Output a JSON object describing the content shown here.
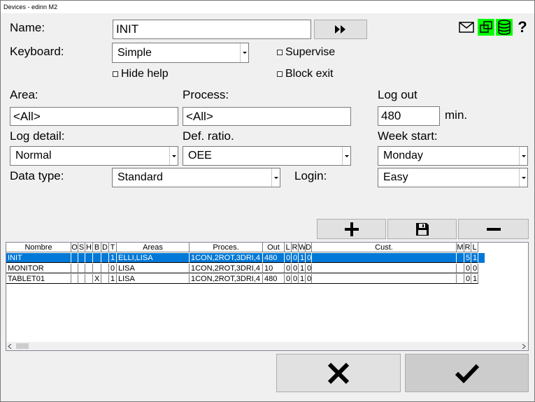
{
  "window": {
    "title": "Devices - edinn M2"
  },
  "form": {
    "name_label": "Name:",
    "name_value": "INIT",
    "keyboard_label": "Keyboard:",
    "keyboard_value": "Simple",
    "supervise_label": "Supervise",
    "hide_help_label": "Hide help",
    "block_exit_label": "Block exit",
    "area_label": "Area:",
    "area_value": "<All>",
    "process_label": "Process:",
    "process_value": "<All>",
    "logout_label": "Log out",
    "logout_value": "480",
    "logout_unit": "min.",
    "log_detail_label": "Log detail:",
    "log_detail_value": "Normal",
    "def_ratio_label": "Def. ratio.",
    "def_ratio_value": "OEE",
    "week_start_label": "Week start:",
    "week_start_value": "Monday",
    "data_type_label": "Data type:",
    "data_type_value": "Standard",
    "login_label": "Login:",
    "login_value": "Easy"
  },
  "toolbar": {
    "help_label": "?"
  },
  "table": {
    "headers": [
      "Nombre",
      "O",
      "S",
      "H",
      "B",
      "D",
      "T",
      "Areas",
      "Proces.",
      "Out",
      "L",
      "R",
      "W",
      "D",
      "Cust.",
      "M",
      "R",
      "L"
    ],
    "rows": [
      [
        "INIT",
        "",
        "",
        "",
        "",
        "",
        "1",
        "ELLI,LISA",
        "1CON,2ROT,3DRI,4",
        "480",
        "0",
        "0",
        "1",
        "0",
        "",
        "",
        "5",
        "1"
      ],
      [
        "MONITOR",
        "",
        "",
        "",
        "",
        "",
        "0",
        "LISA",
        "1CON,2ROT,3DRI,4",
        "10",
        "0",
        "0",
        "1",
        "0",
        "",
        "",
        "0",
        "0"
      ],
      [
        "TABLET01",
        "",
        "",
        "",
        "X",
        "",
        "1",
        "LISA",
        "1CON,2ROT,3DRI,4",
        "480",
        "0",
        "0",
        "1",
        "0",
        "",
        "",
        "0",
        "1"
      ]
    ]
  },
  "colors": {
    "selection": "#0078d7",
    "icon_highlight": "#00ff00"
  }
}
